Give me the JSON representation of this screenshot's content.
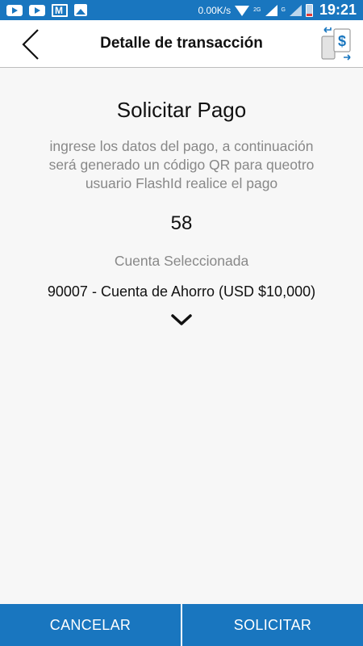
{
  "status_bar": {
    "icons": [
      "youtube-icon",
      "youtube-icon",
      "gmail-icon",
      "image-icon"
    ],
    "network_speed": "0.00K/s",
    "network_2g": "2G",
    "network_g": "G",
    "time": "19:21"
  },
  "header": {
    "title": "Detalle de transacción",
    "back_icon": "chevron-left-icon",
    "logo_icon": "mobile-dollar-icon"
  },
  "main": {
    "heading": "Solicitar Pago",
    "instructions": "ingrese los datos del pago, a continuación será generado un código QR para queotro usuario FlashId realice el pago",
    "amount": "58",
    "account_label": "Cuenta Seleccionada",
    "account_value": "90007 - Cuenta de Ahorro (USD $10,000)",
    "dropdown_icon": "chevron-down-icon"
  },
  "footer": {
    "cancel_label": "CANCELAR",
    "submit_label": "SOLICITAR"
  },
  "colors": {
    "primary": "#1976bf",
    "background": "#f7f7f7",
    "muted_text": "#888888"
  }
}
